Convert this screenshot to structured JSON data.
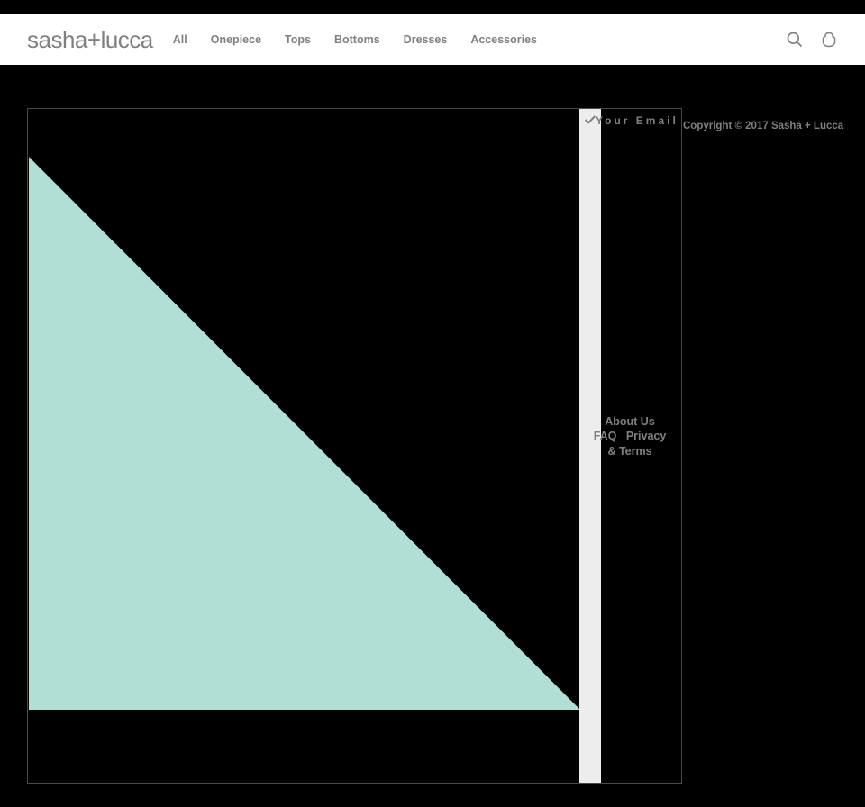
{
  "header": {
    "logo": "sasha+lucca",
    "nav": [
      {
        "label": "All"
      },
      {
        "label": "Onepiece"
      },
      {
        "label": "Tops"
      },
      {
        "label": "Bottoms"
      },
      {
        "label": "Dresses"
      },
      {
        "label": "Accessories"
      }
    ]
  },
  "newsletter": {
    "placeholder_label": "Your Email"
  },
  "footer": {
    "copyright": "Copyright © 2017 Sasha + Lucca",
    "links": {
      "about": "About Us",
      "faq": "FAQ",
      "privacy_terms": "Privacy & Terms"
    }
  }
}
